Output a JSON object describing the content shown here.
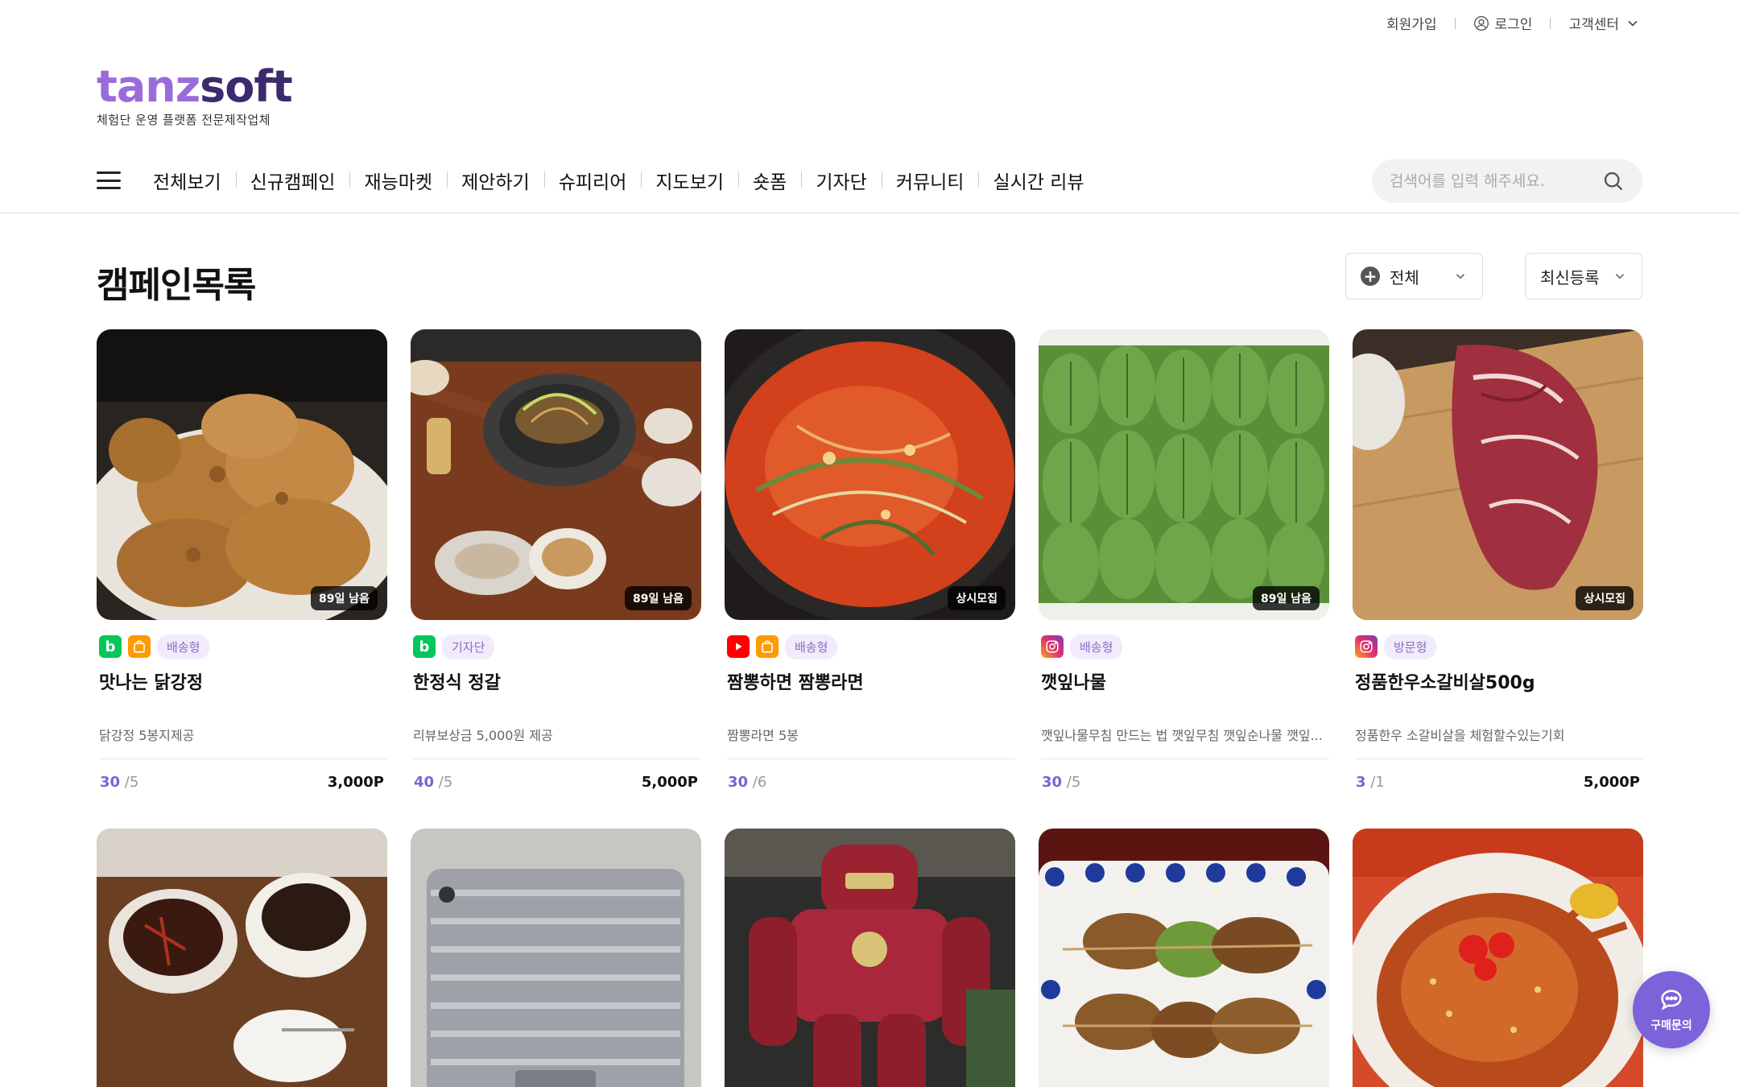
{
  "util": {
    "signup": "회원가입",
    "login": "로그인",
    "support": "고객센터"
  },
  "logo": {
    "word_a": "tanz",
    "word_b": "soft",
    "tagline": "체험단 운영 플랫폼 전문제작업체"
  },
  "nav": {
    "items": [
      "전체보기",
      "신규캠페인",
      "재능마켓",
      "제안하기",
      "슈피리어",
      "지도보기",
      "숏폼",
      "기자단",
      "커뮤니티",
      "실시간 리뷰"
    ]
  },
  "search": {
    "placeholder": "검색어를 입력 해주세요."
  },
  "list": {
    "title": "캠페인목록",
    "type_filter": "전체",
    "sort": "최신등록"
  },
  "cards": [
    {
      "title": "맛나는 닭강정",
      "desc": "닭강정 5봉지제공",
      "tag": "배송형",
      "days": "89일 남음",
      "count": "30",
      "total": "/5",
      "points": "3,000P"
    },
    {
      "title": "한정식 정갈",
      "desc": "리뷰보상금 5,000원 제공",
      "tag": "기자단",
      "days": "89일 남음",
      "count": "40",
      "total": "/5",
      "points": "5,000P"
    },
    {
      "title": "짬뽕하면 짬뽕라면",
      "desc": "짬뽕라면 5봉",
      "tag": "배송형",
      "days": "상시모집",
      "count": "30",
      "total": "/6",
      "points": ""
    },
    {
      "title": "깻잎나물",
      "desc": "깻잎나물무침 만드는 법 깻잎무침 깻잎순나물 깻잎...",
      "tag": "배송형",
      "days": "89일 남음",
      "count": "30",
      "total": "/5",
      "points": ""
    },
    {
      "title": "정품한우소갈비살500g",
      "desc": "정품한우 소갈비살을 체험할수있는기회",
      "tag": "방문형",
      "days": "상시모집",
      "count": "3",
      "total": "/1",
      "points": "5,000P"
    }
  ],
  "fab": {
    "label": "구매문의"
  }
}
